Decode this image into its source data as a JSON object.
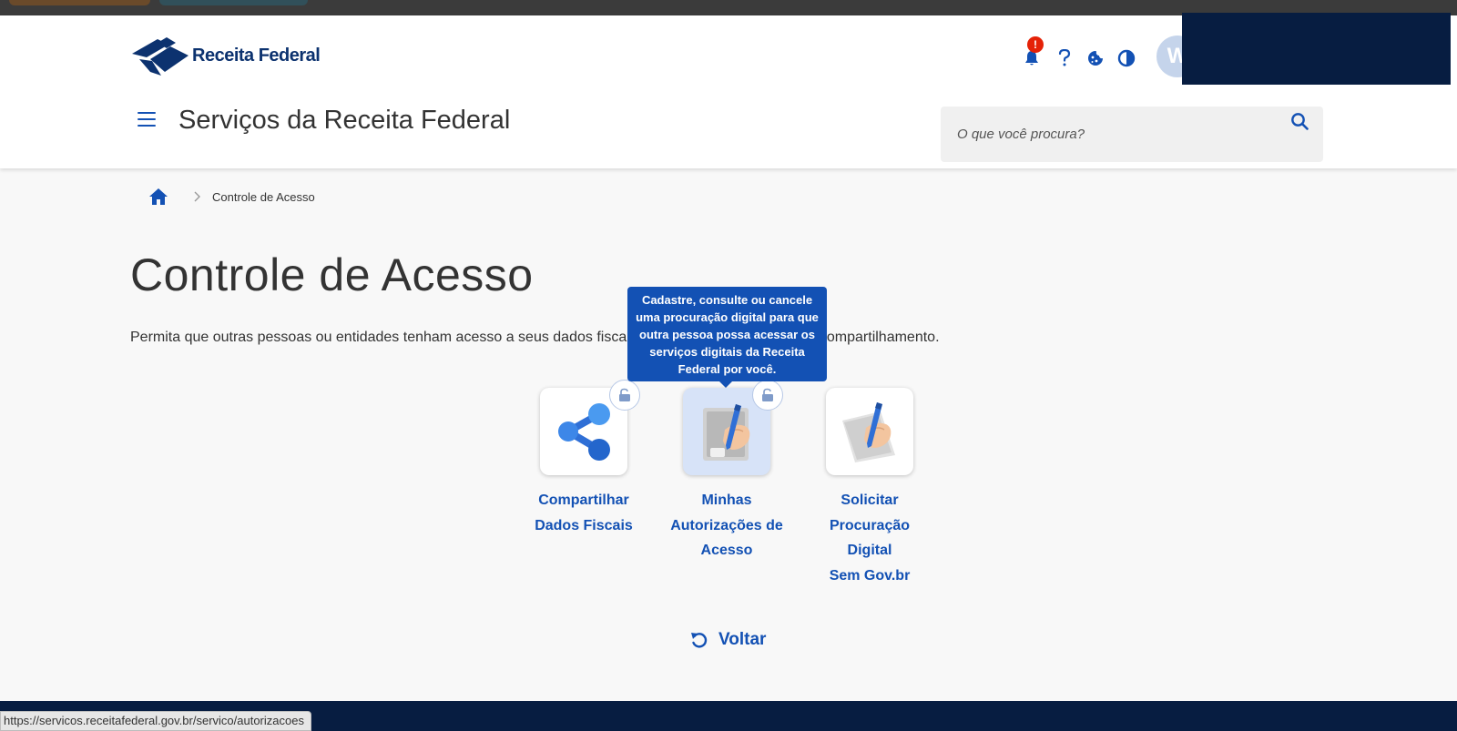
{
  "header": {
    "logo_text": "Receita Federal",
    "site_title": "Serviços da Receita Federal",
    "notification_badge": "!",
    "avatar_initial": "W",
    "search": {
      "placeholder": "O que você procura?"
    },
    "icons": [
      "bell-icon",
      "help-icon",
      "cookie-icon",
      "contrast-icon",
      "search-icon",
      "menu-icon"
    ]
  },
  "breadcrumb": {
    "current": "Controle de Acesso"
  },
  "page": {
    "title": "Controle de Acesso",
    "description": "Permita que outras pessoas ou entidades tenham acesso a seus dados fiscais por meio de procuração ou compartilhamento.",
    "tooltip": "Cadastre, consulte ou cancele uma procuração digital para que outra pessoa possa acessar os serviços digitais da Receita Federal por você."
  },
  "services": [
    {
      "line1": "Compartilhar",
      "line2": "Dados Fiscais",
      "line3": "",
      "icon": "share-icon",
      "locked": true
    },
    {
      "line1": "Minhas",
      "line2": "Autorizações de",
      "line3": "Acesso",
      "icon": "hand-pen-icon",
      "locked": true
    },
    {
      "line1": "Solicitar",
      "line2": "Procuração Digital",
      "line3": "Sem Gov.br",
      "icon": "hand-pen-document-icon",
      "locked": false
    }
  ],
  "back": {
    "label": "Voltar"
  },
  "status_bar": {
    "url": "https://servicos.receitafederal.gov.br/servico/autorizacoes"
  },
  "colors": {
    "primary": "#1351b4",
    "dark_blue": "#071d41",
    "alert": "#e52207"
  }
}
